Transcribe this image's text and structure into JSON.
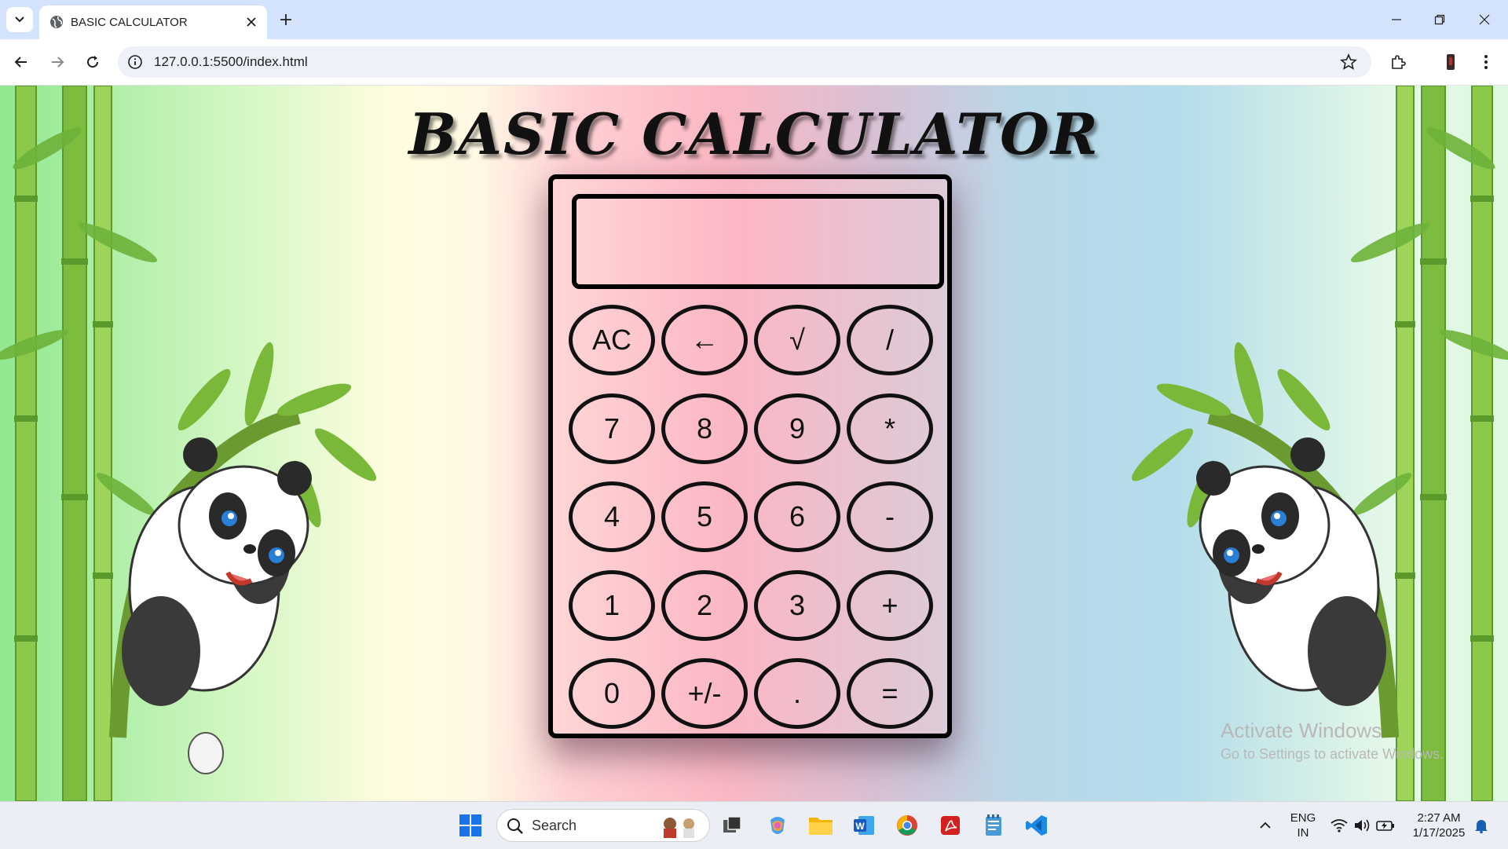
{
  "browser": {
    "tab_title": "BASIC CALCULATOR",
    "url": "127.0.0.1:5500/index.html"
  },
  "page": {
    "title": "BASIC CALCULATOR"
  },
  "calculator": {
    "display_value": "",
    "keys": [
      {
        "label": "AC",
        "name": "key-ac"
      },
      {
        "label": "←",
        "name": "key-backspace"
      },
      {
        "label": "√",
        "name": "key-sqrt"
      },
      {
        "label": "/",
        "name": "key-divide"
      },
      {
        "label": "7",
        "name": "key-7"
      },
      {
        "label": "8",
        "name": "key-8"
      },
      {
        "label": "9",
        "name": "key-9"
      },
      {
        "label": "*",
        "name": "key-multiply"
      },
      {
        "label": "4",
        "name": "key-4"
      },
      {
        "label": "5",
        "name": "key-5"
      },
      {
        "label": "6",
        "name": "key-6"
      },
      {
        "label": "-",
        "name": "key-subtract"
      },
      {
        "label": "1",
        "name": "key-1"
      },
      {
        "label": "2",
        "name": "key-2"
      },
      {
        "label": "3",
        "name": "key-3"
      },
      {
        "label": "+",
        "name": "key-add"
      },
      {
        "label": "0",
        "name": "key-0"
      },
      {
        "label": "+/-",
        "name": "key-sign"
      },
      {
        "label": ".",
        "name": "key-decimal"
      },
      {
        "label": "=",
        "name": "key-equals"
      }
    ]
  },
  "watermark": {
    "line1": "Activate Windows",
    "line2": "Go to Settings to activate Windows."
  },
  "taskbar": {
    "search_label": "Search",
    "lang_line1": "ENG",
    "lang_line2": "IN",
    "time": "2:27 AM",
    "date": "1/17/2025"
  }
}
